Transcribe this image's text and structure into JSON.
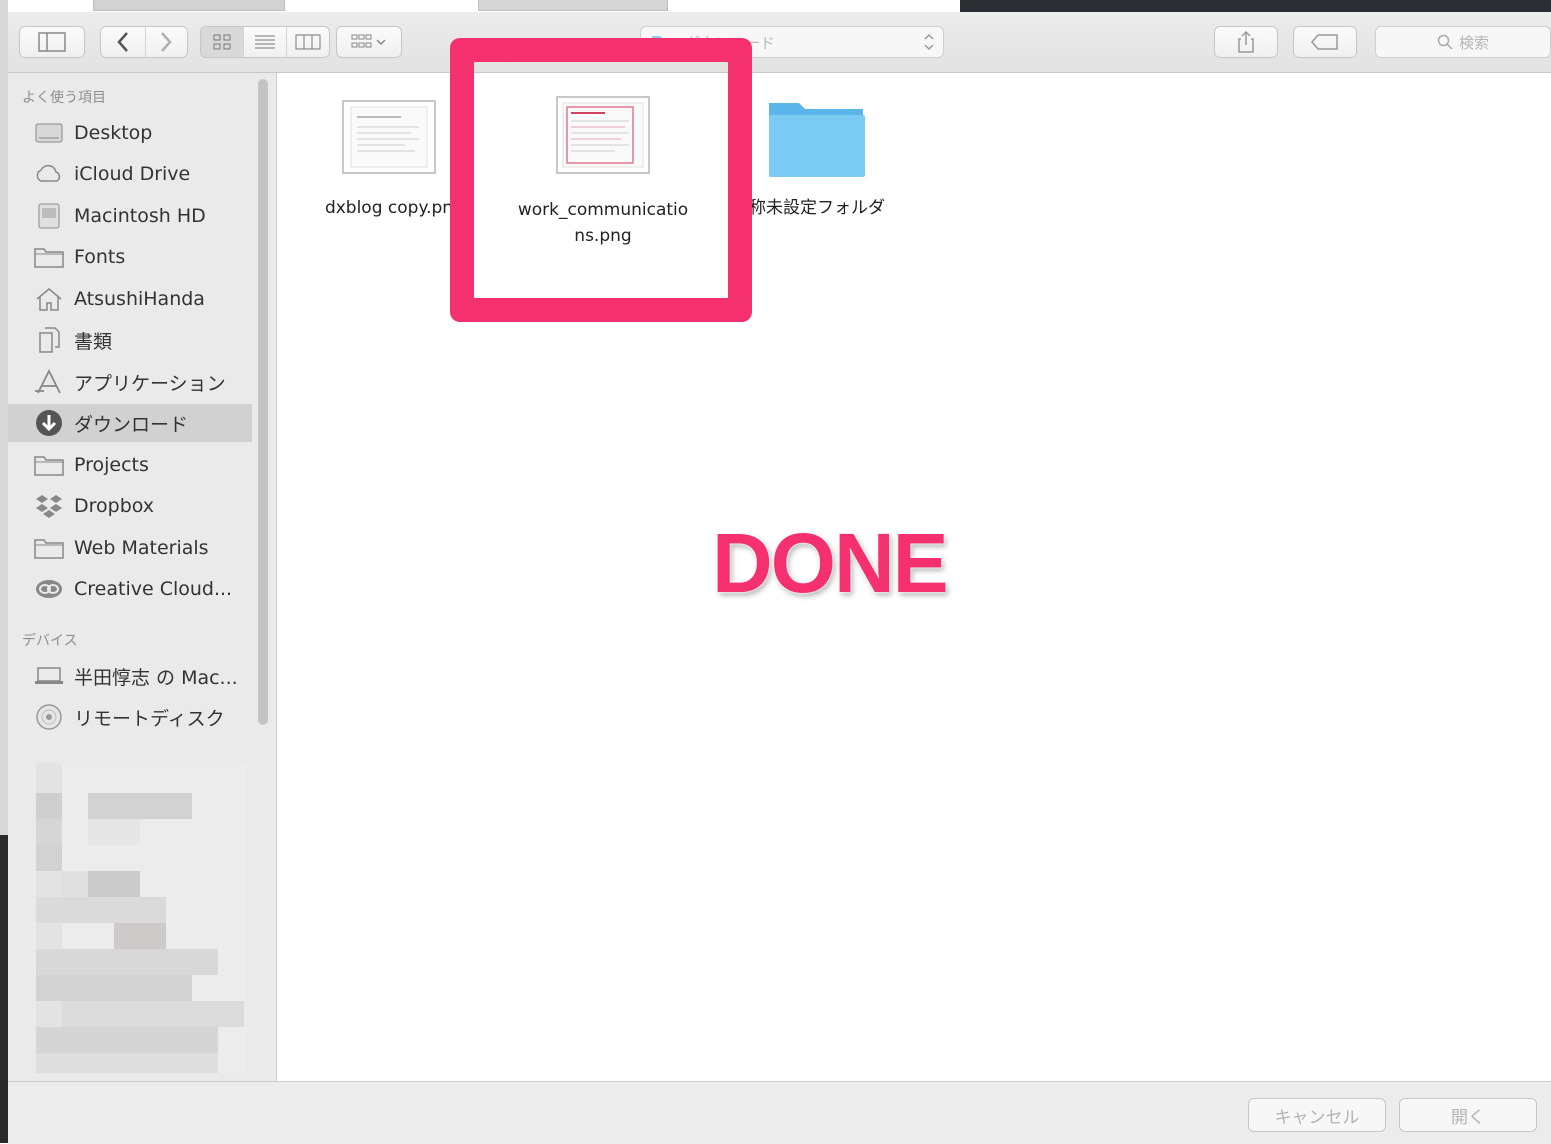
{
  "window": {
    "location_label": "ダウンロード"
  },
  "toolbar": {
    "search_placeholder": "検索"
  },
  "sidebar": {
    "favorites_heading": "よく使う項目",
    "favorites": [
      {
        "label": "Desktop",
        "icon": "desktop-icon"
      },
      {
        "label": "iCloud Drive",
        "icon": "cloud-icon"
      },
      {
        "label": "Macintosh HD",
        "icon": "hard-drive-icon"
      },
      {
        "label": "Fonts",
        "icon": "folder-icon"
      },
      {
        "label": "AtsushiHanda",
        "icon": "home-icon"
      },
      {
        "label": "書類",
        "icon": "documents-icon"
      },
      {
        "label": "アプリケーション",
        "icon": "applications-icon"
      },
      {
        "label": "ダウンロード",
        "icon": "download-icon",
        "selected": true
      },
      {
        "label": "Projects",
        "icon": "folder-icon"
      },
      {
        "label": "Dropbox",
        "icon": "dropbox-icon"
      },
      {
        "label": "Web Materials",
        "icon": "folder-icon"
      },
      {
        "label": "Creative Cloud...",
        "icon": "creative-cloud-icon"
      }
    ],
    "devices_heading": "デバイス",
    "devices": [
      {
        "label": "半田惇志 の Mac...",
        "icon": "laptop-icon"
      },
      {
        "label": "リモートディスク",
        "icon": "disc-icon"
      }
    ]
  },
  "files": [
    {
      "name": "dxblog copy.pn",
      "icon": "image-file-icon"
    },
    {
      "name": "work_communications.png",
      "name_line1": "work_communicatio",
      "name_line2": "ns.png",
      "icon": "image-file-icon",
      "highlighted": true
    },
    {
      "name": "称未設定フォルダ",
      "icon": "folder-icon"
    }
  ],
  "annotation": {
    "text": "DONE",
    "color": "#f4306f"
  },
  "footer": {
    "cancel_label": "キャンセル",
    "open_label": "開く"
  },
  "colors": {
    "accent_annotation": "#f4306f",
    "folder_blue": "#6ec4f2",
    "sidebar_selected": "#d1d1d1"
  }
}
